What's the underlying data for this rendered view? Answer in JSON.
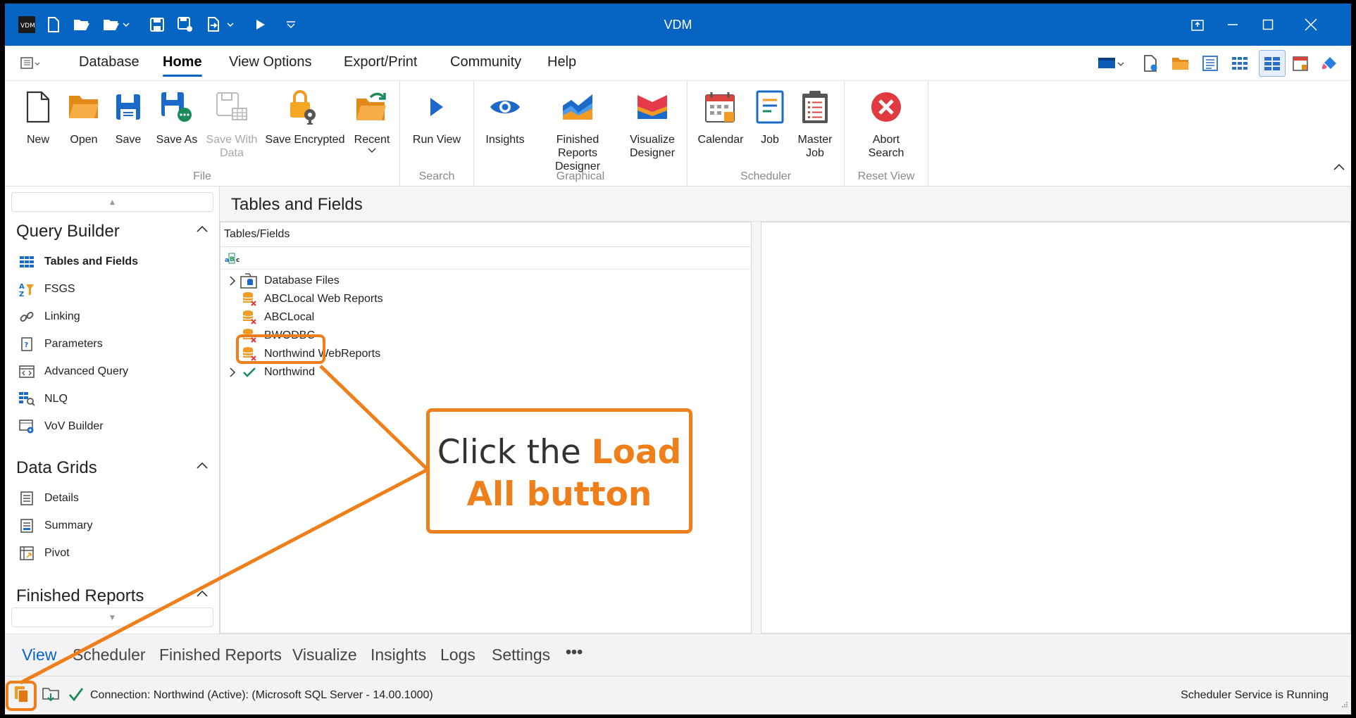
{
  "window": {
    "title": "VDM"
  },
  "menu": {
    "items": [
      "Database",
      "Home",
      "View Options",
      "Export/Print",
      "Community",
      "Help"
    ],
    "active": "Home"
  },
  "ribbon": {
    "file": {
      "label": "File",
      "new": "New",
      "open": "Open",
      "save": "Save",
      "save_as": "Save As",
      "save_with_data": "Save With Data",
      "save_encrypted": "Save Encrypted",
      "recent": "Recent"
    },
    "search": {
      "label": "Search",
      "run_view": "Run View"
    },
    "graphical": {
      "label": "Graphical",
      "insights": "Insights",
      "finished_reports_designer": "Finished Reports Designer",
      "visualize_designer": "Visualize Designer"
    },
    "scheduler": {
      "label": "Scheduler",
      "calendar": "Calendar",
      "job": "Job",
      "master_job": "Master Job"
    },
    "reset_view": {
      "label": "Reset View",
      "abort_search": "Abort Search"
    }
  },
  "leftnav": {
    "query_builder": {
      "title": "Query Builder",
      "items": [
        "Tables and Fields",
        "FSGS",
        "Linking",
        "Parameters",
        "Advanced Query",
        "NLQ",
        "VoV Builder"
      ]
    },
    "data_grids": {
      "title": "Data Grids",
      "items": [
        "Details",
        "Summary",
        "Pivot"
      ]
    },
    "finished_reports": {
      "title": "Finished Reports"
    }
  },
  "main": {
    "title": "Tables and Fields",
    "tree_header": "Tables/Fields",
    "tree": [
      {
        "label": "Database Files",
        "expandable": true
      },
      {
        "label": "ABCLocal Web Reports",
        "expandable": false
      },
      {
        "label": "ABCLocal",
        "expandable": false
      },
      {
        "label": "BWODBC",
        "expandable": false
      },
      {
        "label": "Northwind WebReports",
        "expandable": false
      },
      {
        "label": "Northwind",
        "expandable": true
      }
    ]
  },
  "bottom_tabs": [
    "View",
    "Scheduler",
    "Finished Reports",
    "Visualize",
    "Insights",
    "Logs",
    "Settings",
    "•••"
  ],
  "status": {
    "connection": "Connection: Northwind (Active): (Microsoft SQL Server - 14.00.1000)",
    "scheduler": "Scheduler Service is Running"
  },
  "callout": {
    "prefix": "Click the ",
    "highlight": "Load All button"
  },
  "colors": {
    "accent": "#0664c2",
    "annotation": "#ef7f1a"
  }
}
